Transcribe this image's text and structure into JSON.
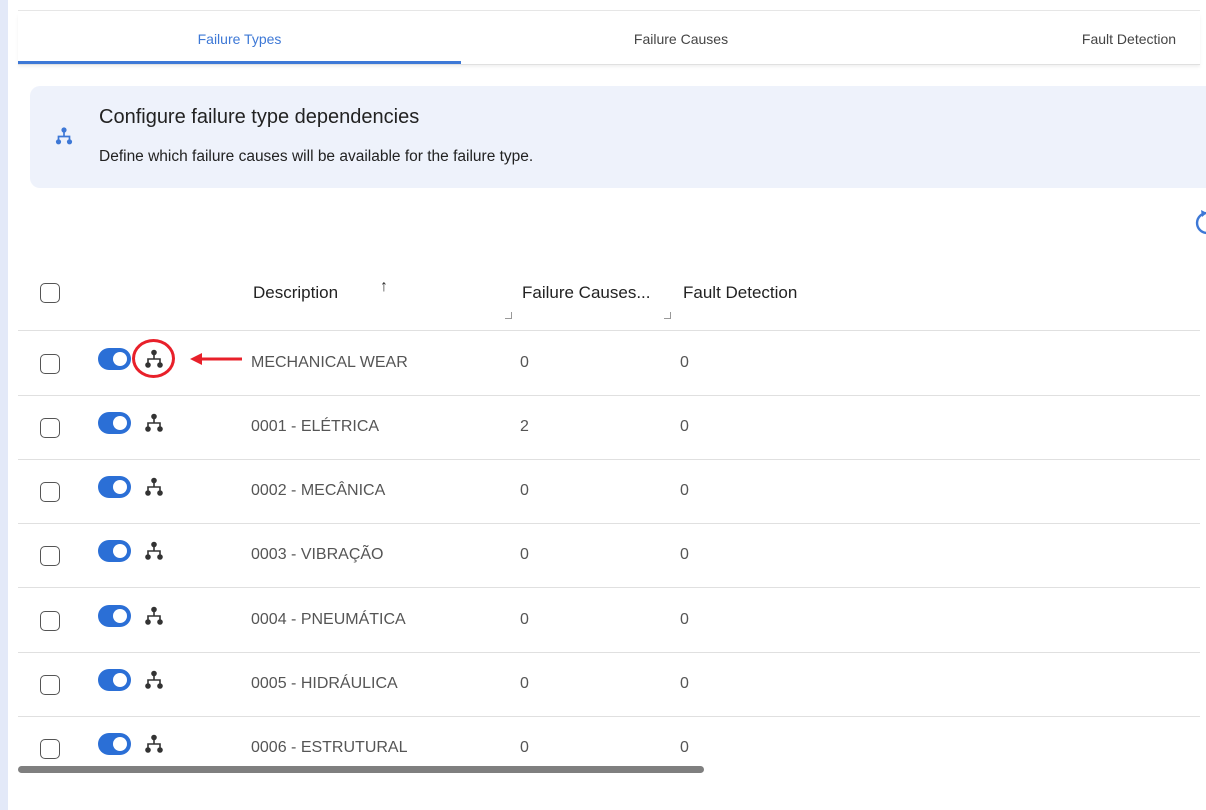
{
  "tabs": [
    {
      "label": "Failure Types",
      "active": true
    },
    {
      "label": "Failure Causes",
      "active": false
    },
    {
      "label": "Fault Detection",
      "active": false
    }
  ],
  "banner": {
    "icon": "hierarchy-icon",
    "title": "Configure failure type dependencies",
    "description": "Define which failure causes will be available for the failure type."
  },
  "table": {
    "columns": {
      "description": "Description",
      "failure_causes": "Failure Causes...",
      "fault_detection": "Fault Detection"
    },
    "sort": {
      "column": "description",
      "direction": "ascending"
    },
    "rows": [
      {
        "description": "MECHANICAL WEAR",
        "failure_causes": "0",
        "fault_detection": "0",
        "active": true,
        "highlighted": true
      },
      {
        "description": "0001 - ELÉTRICA",
        "failure_causes": "2",
        "fault_detection": "0",
        "active": true
      },
      {
        "description": "0002 - MECÂNICA",
        "failure_causes": "0",
        "fault_detection": "0",
        "active": true
      },
      {
        "description": "0003 - VIBRAÇÃO",
        "failure_causes": "0",
        "fault_detection": "0",
        "active": true
      },
      {
        "description": "0004 - PNEUMÁTICA",
        "failure_causes": "0",
        "fault_detection": "0",
        "active": true
      },
      {
        "description": "0005 - HIDRÁULICA",
        "failure_causes": "0",
        "fault_detection": "0",
        "active": true
      },
      {
        "description": "0006 - ESTRUTURAL",
        "failure_causes": "0",
        "fault_detection": "0",
        "active": true
      }
    ]
  },
  "colors": {
    "accent": "#3d78d6",
    "toggle_on": "#2b6fd6",
    "banner_bg": "#eef2fb",
    "annotation": "#e8202a"
  }
}
